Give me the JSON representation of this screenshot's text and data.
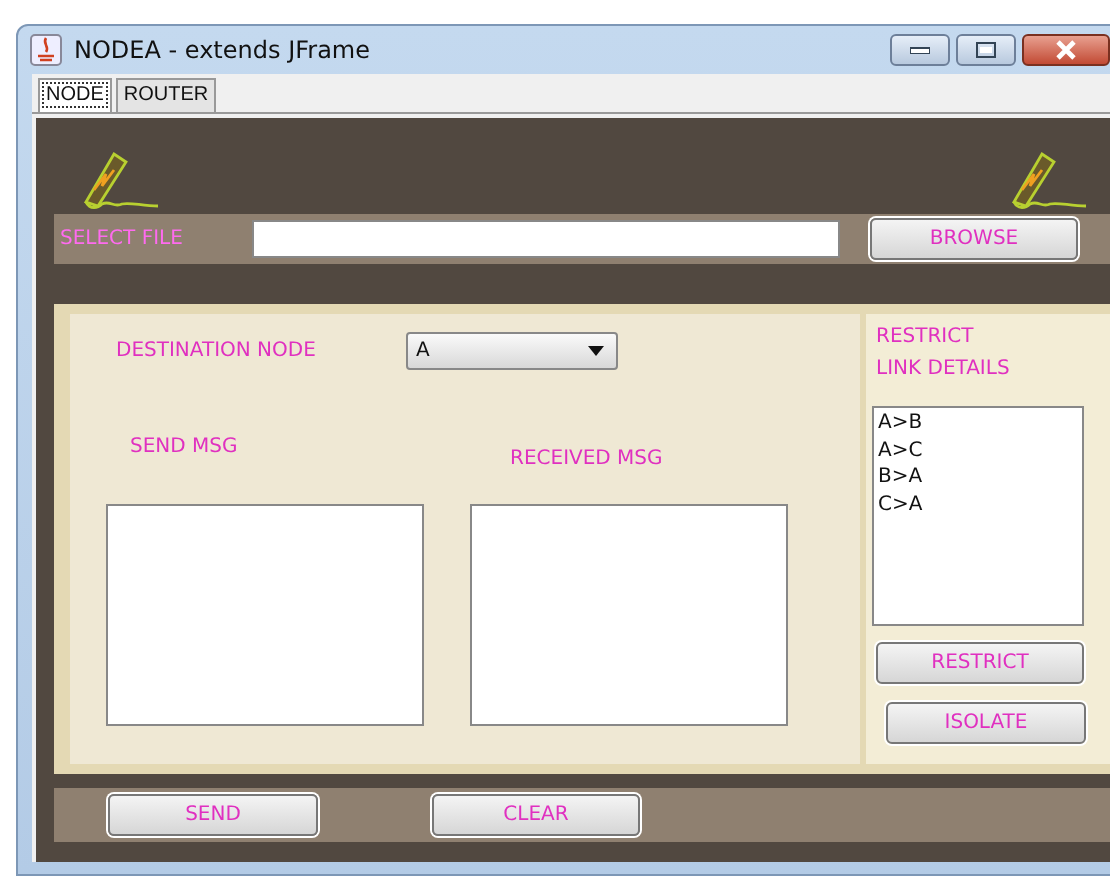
{
  "window": {
    "title": "NODEA - extends JFrame"
  },
  "tabs": [
    {
      "label": "NODE",
      "selected": true
    },
    {
      "label": "ROUTER",
      "selected": false
    }
  ],
  "file_row": {
    "label": "SELECT FILE",
    "button": "BROWSE"
  },
  "destination": {
    "label": "DESTINATION NODE",
    "value": "A"
  },
  "send_label": "SEND MSG",
  "received_label": "RECEIVED MSG",
  "restrict_panel": {
    "title_lines": [
      "RESTRICT",
      "LINK DETAILS"
    ],
    "links": [
      "A>B",
      "A>C",
      "B>A",
      "C>A"
    ],
    "buttons": [
      "RESTRICT",
      "ISOLATE"
    ]
  },
  "bottom_buttons": [
    "SEND",
    "CLEAR"
  ]
}
